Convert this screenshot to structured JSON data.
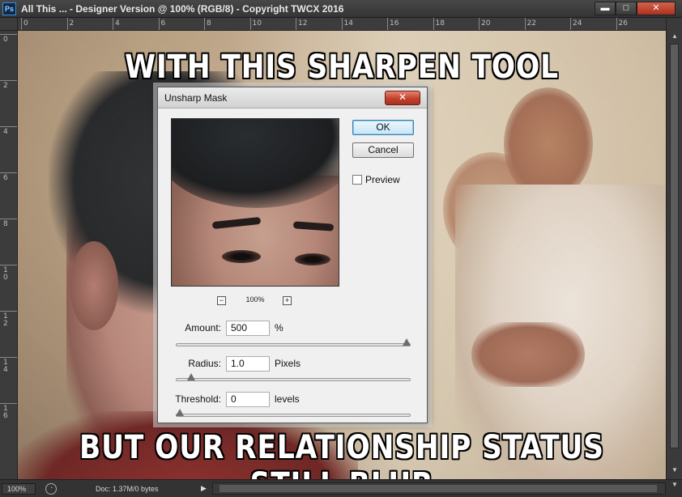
{
  "window": {
    "logo": "Ps",
    "title": "All This ... - Designer Version @ 100% (RGB/8) - Copyright TWCX 2016",
    "min_glyph": "▬",
    "max_glyph": "□",
    "close_glyph": "✕"
  },
  "ruler_top": [
    "0",
    "2",
    "4",
    "6",
    "8",
    "10",
    "12",
    "14",
    "16",
    "18",
    "20",
    "22",
    "24",
    "26"
  ],
  "ruler_left": [
    "0",
    "2",
    "4",
    "6",
    "8",
    "10",
    "12",
    "14",
    "16"
  ],
  "meme": {
    "top_text": "WITH THIS SHARPEN TOOL",
    "bottom_text": "BUT OUR RELATIONSHIP STATUS STILL BLUR"
  },
  "dialog": {
    "title": "Unsharp Mask",
    "close_glyph": "✕",
    "ok_label": "OK",
    "cancel_label": "Cancel",
    "preview_label": "Preview",
    "preview_checked": false,
    "zoom_minus": "−",
    "zoom_plus": "+",
    "zoom_value": "100%",
    "params": {
      "amount": {
        "label": "Amount:",
        "value": "500",
        "unit": "%",
        "slider_fraction": 1.0
      },
      "radius": {
        "label": "Radius:",
        "value": "1.0",
        "unit": "Pixels",
        "slider_fraction": 0.05
      },
      "threshold": {
        "label": "Threshold:",
        "value": "0",
        "unit": "levels",
        "slider_fraction": 0.0
      }
    }
  },
  "status": {
    "zoom": "100%",
    "doc": "Doc: 1.37M/0 bytes",
    "arrow": "▶"
  },
  "scroll": {
    "up": "▲",
    "down": "▼",
    "corner": "▼"
  }
}
